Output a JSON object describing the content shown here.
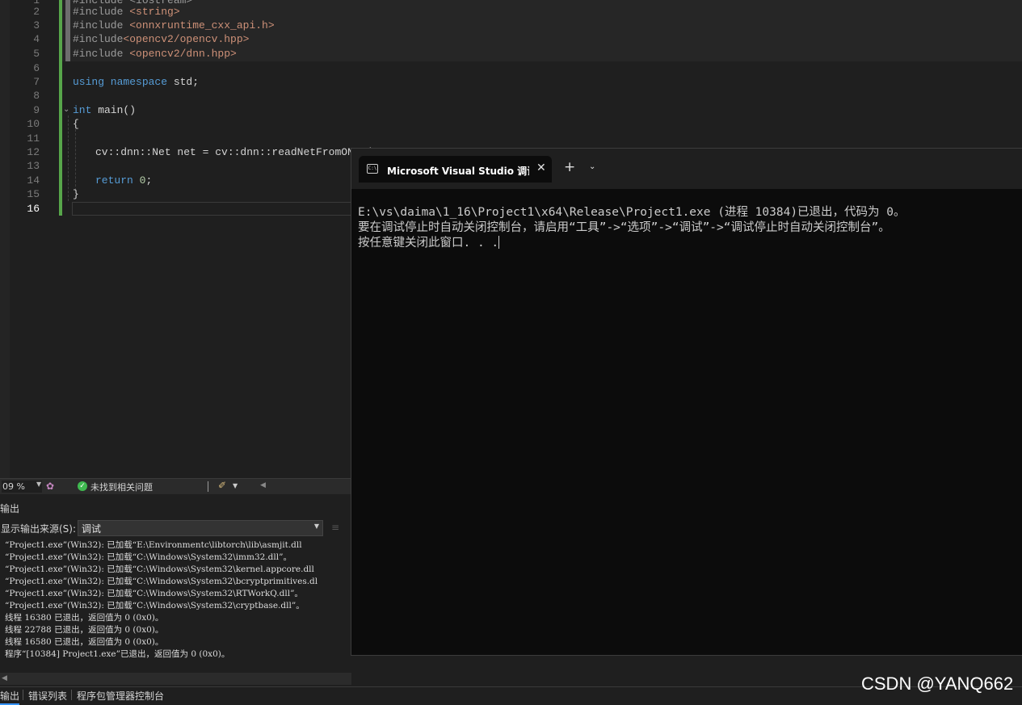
{
  "editor": {
    "lines": [
      {
        "n": "1",
        "code": ""
      },
      {
        "n": "2",
        "pre": "#include ",
        "str": "<string>"
      },
      {
        "n": "3",
        "pre": "#include ",
        "str": "<onnxruntime_cxx_api.h>"
      },
      {
        "n": "4",
        "pre": "#include",
        "str": "<opencv2/opencv.hpp>"
      },
      {
        "n": "5",
        "pre": "#include ",
        "str": "<opencv2/dnn.hpp>"
      },
      {
        "n": "6"
      },
      {
        "n": "7",
        "kw": "using namespace",
        "rest": " std;"
      },
      {
        "n": "8"
      },
      {
        "n": "9",
        "kw": "int",
        "rest": " main()"
      },
      {
        "n": "10",
        "rest": "{"
      },
      {
        "n": "11"
      },
      {
        "n": "12",
        "rest": "cv::dnn::Net net = cv::dnn::readNetFromONNX("
      },
      {
        "n": "13"
      },
      {
        "n": "14",
        "kw": "return",
        "num": "0",
        "end": ";"
      },
      {
        "n": "15",
        "rest": "}"
      },
      {
        "n": "16"
      }
    ],
    "active_line": "16"
  },
  "editor_status": {
    "zoom": "09 %",
    "issues": "未找到相关问题"
  },
  "output": {
    "title": "输出",
    "source_label": "显示输出来源(S):",
    "source_value": "调试",
    "lines": [
      "“Project1.exe”(Win32): 已加载“E:\\Environmentc\\libtorch\\lib\\asmjit.dll",
      "“Project1.exe”(Win32): 已加载“C:\\Windows\\System32\\imm32.dll”。",
      "“Project1.exe”(Win32): 已加载“C:\\Windows\\System32\\kernel.appcore.dll",
      "“Project1.exe”(Win32): 已加载“C:\\Windows\\System32\\bcryptprimitives.dl",
      "“Project1.exe”(Win32): 已加载“C:\\Windows\\System32\\RTWorkQ.dll”。",
      "“Project1.exe”(Win32): 已加载“C:\\Windows\\System32\\cryptbase.dll”。",
      "线程 16380 已退出，返回值为 0 (0x0)。",
      "线程 22788 已退出，返回值为 0 (0x0)。",
      "线程 16580 已退出，返回值为 0 (0x0)。",
      "程序“[10384] Project1.exe”已退出，返回值为 0 (0x0)。"
    ]
  },
  "bottom_tabs": [
    "输出",
    "错误列表",
    "程序包管理器控制台"
  ],
  "terminal": {
    "tab_title": "Microsoft Visual Studio 调试控",
    "lines": [
      "E:\\vs\\daima\\1_16\\Project1\\x64\\Release\\Project1.exe (进程 10384)已退出，代码为 0。",
      "要在调试停止时自动关闭控制台，请启用“工具”->“选项”->“调试”->“调试停止时自动关闭控制台”。",
      "按任意键关闭此窗口. . ."
    ]
  },
  "watermark": "CSDN @YANQ662",
  "colors": {
    "editor_bg": "#1f1f1f",
    "terminal_bg": "#0c0c0c",
    "keyword": "#569cd6",
    "string": "#ce9178",
    "margin_green": "#57a64a",
    "ok_green": "#3fb950"
  }
}
